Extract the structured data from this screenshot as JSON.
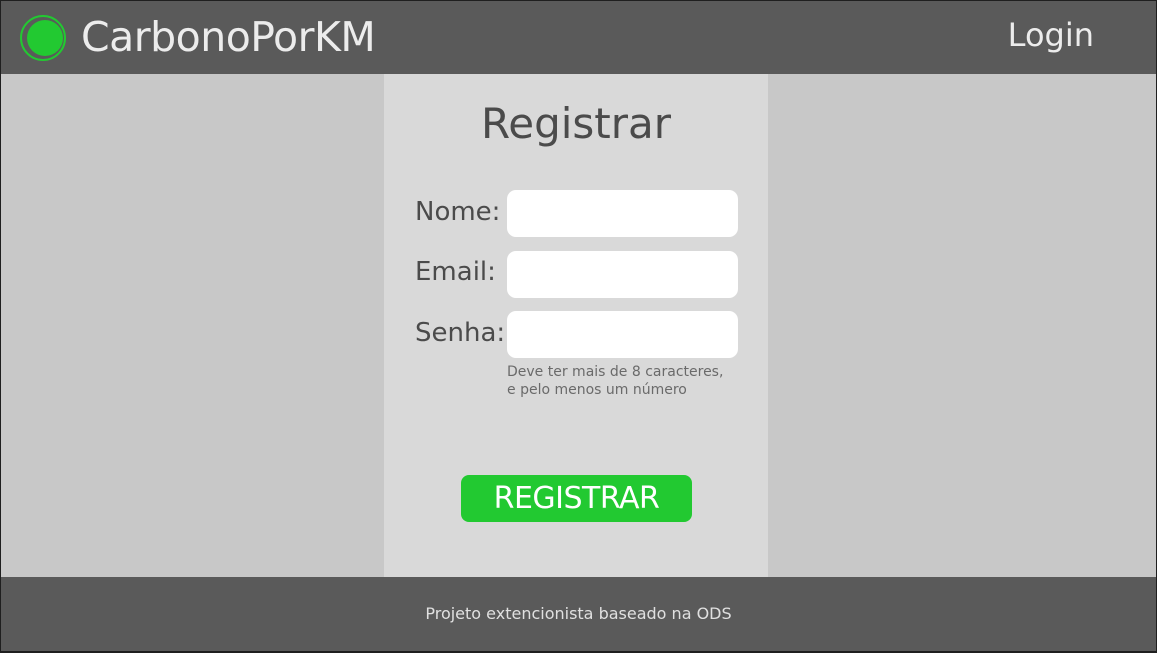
{
  "header": {
    "app_title": "CarbonoPorKM",
    "login_label": "Login"
  },
  "form": {
    "title": "Registrar",
    "fields": [
      {
        "label": "Nome:",
        "value": "",
        "placeholder": ""
      },
      {
        "label": "Email:",
        "value": "",
        "placeholder": ""
      },
      {
        "label": "Senha:",
        "value": "",
        "placeholder": ""
      }
    ],
    "password_hint_line1": "Deve ter mais de 8 caracteres,",
    "password_hint_line2": "e pelo menos um número",
    "submit_label": "REGISTRAR"
  },
  "footer": {
    "text": "Projeto extencionista baseado na ODS"
  },
  "icons": {
    "logo": "logo-circle-icon"
  },
  "colors": {
    "accent": "#22c931",
    "header_bg": "#5a5a5a",
    "page_bg": "#c8c8c8",
    "panel_bg": "#d9d9d9"
  }
}
